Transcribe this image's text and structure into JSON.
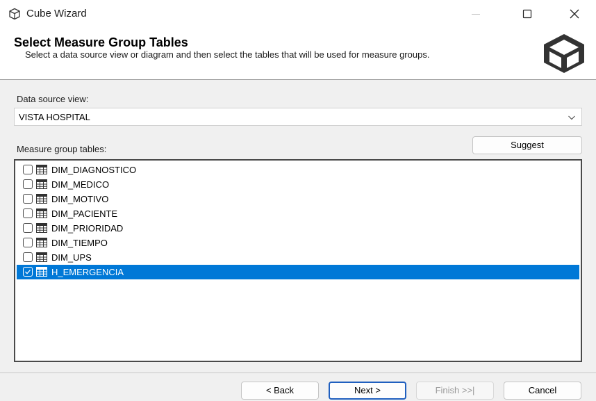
{
  "window": {
    "title": "Cube Wizard",
    "icon": "cube-icon",
    "controls": [
      "minimize-icon",
      "maximize-icon",
      "close-icon"
    ]
  },
  "header": {
    "title": "Select Measure Group Tables",
    "subtitle": "Select a data source view or diagram and then select the tables that will be used for measure groups.",
    "logo": "cube-logo-icon"
  },
  "data_source_view": {
    "label": "Data source view:",
    "value": "VISTA HOSPITAL"
  },
  "measure_group": {
    "label": "Measure group tables:",
    "suggest_label": "Suggest",
    "tables": [
      {
        "name": "DIM_DIAGNOSTICO",
        "checked": false,
        "selected": false
      },
      {
        "name": "DIM_MEDICO",
        "checked": false,
        "selected": false
      },
      {
        "name": "DIM_MOTIVO",
        "checked": false,
        "selected": false
      },
      {
        "name": "DIM_PACIENTE",
        "checked": false,
        "selected": false
      },
      {
        "name": "DIM_PRIORIDAD",
        "checked": false,
        "selected": false
      },
      {
        "name": "DIM_TIEMPO",
        "checked": false,
        "selected": false
      },
      {
        "name": "DIM_UPS",
        "checked": false,
        "selected": false
      },
      {
        "name": "H_EMERGENCIA",
        "checked": true,
        "selected": true
      }
    ]
  },
  "footer": {
    "back_label": "< Back",
    "next_label": "Next >",
    "finish_label": "Finish >>|",
    "cancel_label": "Cancel"
  },
  "colors": {
    "selection": "#0078d7",
    "default_button_border": "#1f5fbf",
    "disabled_text": "#9b9b9b"
  }
}
